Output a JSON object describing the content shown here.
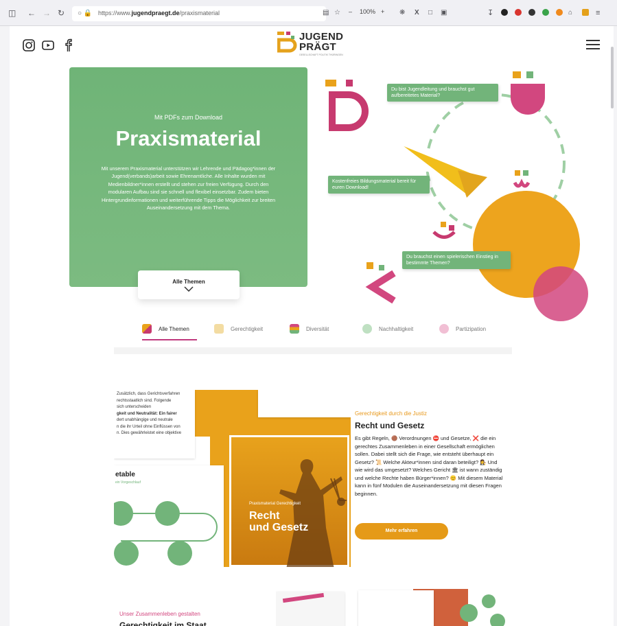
{
  "browser": {
    "url_prefix": "https://www.",
    "url_domain": "jugendpraegt.de",
    "url_path": "/praxismaterial",
    "zoom": "100%",
    "zoom_minus": "–",
    "zoom_plus": "+"
  },
  "logo": {
    "line1": "JUGEND",
    "line2": "PRÄGT",
    "subline": "GESELLSCHAFT POLITIK THÜRINGEN"
  },
  "hero": {
    "kicker": "Mit PDFs zum Download",
    "title": "Praxismaterial",
    "body": "Mit unserem Praxismaterial unterstützen wir Lehrende und Pädagog*innen der Jugend(verbands)arbeit sowie Ehrenamtliche. Alle Inhalte wurden mit Medienbildner*innen erstellt und stehen zur freien Verfügung. Durch den modularen Aufbau sind sie schnell und flexibel einsetzbar. Zudem bieten Hintergrundinformationen und weiterführende Tipps die Möglichkeit zur breiten Auseinandersetzung mit dem Thema.",
    "all_topics_label": "Alle Themen"
  },
  "bubbles": {
    "b1": "Du bist Jugendleitung und brauchst gut aufbereitetes Material?",
    "b2": "Kostenfreies Bildungsmaterial bereit für euren Download!",
    "b3": "Du brauchst einen spielerischen Einstieg in bestimmte Themen?"
  },
  "tabs": [
    {
      "label": "Alle Themen",
      "active": true
    },
    {
      "label": "Gerechtigkeit",
      "active": false
    },
    {
      "label": "Diversität",
      "active": false
    },
    {
      "label": "Nachhaltigkeit",
      "active": false
    },
    {
      "label": "Partizipation",
      "active": false
    }
  ],
  "card1": {
    "kicker": "Gerechtigkeit durch die Justiz",
    "title": "Recht und Gesetz",
    "body": "Es gibt Regeln, 🟤 Verordnungen ⛔ und Gesetze, ❌ die ein gerechtes Zusammenleben in einer Gesellschaft ermöglichen sollen. Dabei stellt sich die Frage, wie entsteht überhaupt ein Gesetz? 📜 Welche Akteur*innen sind daran beteiligt? 👩‍⚖️ Und wie wird das umgesetzt? Welches Gericht 🏛 ist wann zuständig und welche Rechte haben Bürger*innen? 😊 Mit diesem Material kann in fünf Modulen die Auseinandersetzung mit diesen Fragen beginnen.",
    "button": "Mehr erfahren",
    "cover_kicker": "Praxismaterial Gerechtigkeit",
    "cover_title_1": "Recht",
    "cover_title_2": "und Gesetz",
    "doc_left_lines": [
      "Zusätzlich, dass Gerichtsverfahren",
      "rechtsstaatlich sind. Folgende",
      "sich unterscheiden",
      "gkeit und Neutralität: Ein fairer",
      "dert unabhängige und neutrale",
      "n die ihr Urteil ohne Einflüssen von",
      "n. Dies gewährleistet eine objektive"
    ],
    "doc_table_title": "etable",
    "doc_table_sub": "ein Vorgeschlauf"
  },
  "card2": {
    "kicker": "Unser Zusammenleben gestalten",
    "title": "Gerechtigkeit im Staat"
  }
}
